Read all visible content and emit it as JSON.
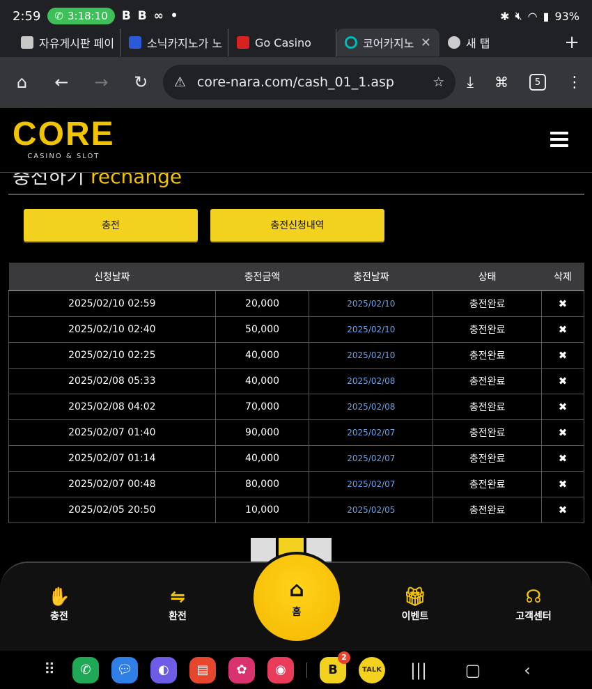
{
  "status": {
    "time": "2:59",
    "call_timer": "3:18:10",
    "icons": "B B ∞ •",
    "battery": "93%"
  },
  "tabs": [
    {
      "label": "자유게시판 페이",
      "fav_color": "#c8c8c8",
      "active": false
    },
    {
      "label": "소닉카지노가 노",
      "fav_color": "#2b59d9",
      "active": false
    },
    {
      "label": "Go Casino",
      "fav_color": "#d82121",
      "active": false
    },
    {
      "label": "코어카지노",
      "fav_color": "#0bb",
      "active": true
    },
    {
      "label": "새 탭",
      "fav_color": "#ccc",
      "active": false
    }
  ],
  "toolbar": {
    "url": "core-nara.com/cash_01_1.asp",
    "tab_count": "5"
  },
  "site": {
    "logo": "CORE",
    "logo_sub": "CASINO & SLOT"
  },
  "page": {
    "title_kr": "충전하기",
    "title_en": "rechange"
  },
  "buttons": {
    "charge": "충전",
    "history": "충전신청내역"
  },
  "table": {
    "headers": [
      "신청날짜",
      "충전금액",
      "충전날짜",
      "상태",
      "삭제"
    ],
    "rows": [
      {
        "requested": "2025/02/10 02:59",
        "amount": "20,000",
        "date": "2025/02/10",
        "status": "충전완료"
      },
      {
        "requested": "2025/02/10 02:40",
        "amount": "50,000",
        "date": "2025/02/10",
        "status": "충전완료"
      },
      {
        "requested": "2025/02/10 02:25",
        "amount": "40,000",
        "date": "2025/02/10",
        "status": "충전완료"
      },
      {
        "requested": "2025/02/08 05:33",
        "amount": "40,000",
        "date": "2025/02/08",
        "status": "충전완료"
      },
      {
        "requested": "2025/02/08 04:02",
        "amount": "70,000",
        "date": "2025/02/08",
        "status": "충전완료"
      },
      {
        "requested": "2025/02/07 01:40",
        "amount": "90,000",
        "date": "2025/02/07",
        "status": "충전완료"
      },
      {
        "requested": "2025/02/07 01:14",
        "amount": "40,000",
        "date": "2025/02/07",
        "status": "충전완료"
      },
      {
        "requested": "2025/02/07 00:48",
        "amount": "80,000",
        "date": "2025/02/07",
        "status": "충전완료"
      },
      {
        "requested": "2025/02/05 20:50",
        "amount": "10,000",
        "date": "2025/02/05",
        "status": "충전완료"
      }
    ],
    "delete_glyph": "✖"
  },
  "bottom_nav": {
    "charge": "충전",
    "exchange": "환전",
    "home": "홈",
    "event": "이벤트",
    "support": "고객센터"
  },
  "android": {
    "b_badge": "2",
    "talk_label": "TALK"
  }
}
